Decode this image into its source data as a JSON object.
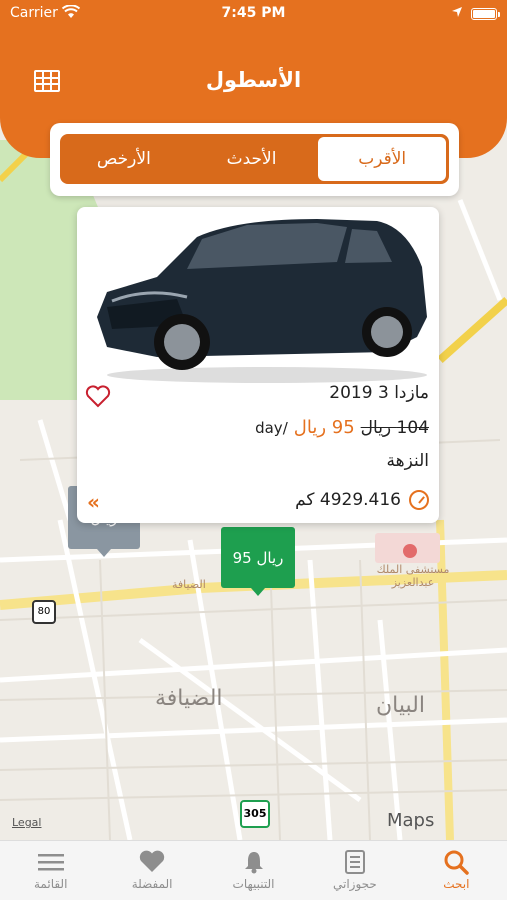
{
  "status_bar": {
    "carrier": "Carrier",
    "time": "7:45 PM"
  },
  "header": {
    "title": "الأسطول",
    "grid_icon": "grid-icon"
  },
  "sort": {
    "options": [
      {
        "label": "الأرخص",
        "active": false
      },
      {
        "label": "الأحدث",
        "active": false
      },
      {
        "label": "الأقرب",
        "active": true
      }
    ]
  },
  "car": {
    "name": "مازدا 3 2019",
    "old_price": "104 ريال",
    "price": "95 ريال",
    "per": "/day",
    "location": "النزهة",
    "distance": "4929.416 كم"
  },
  "map": {
    "pin_price": "95 ريال",
    "gray_pin_text": "ريال",
    "places": {
      "hospital": "مستشفى الملك عبدالعزيز",
      "dhiyafa": "الضيافة",
      "bayan": "البيان",
      "poi": "الضيافة",
      "road_80": "80",
      "road_305": "305"
    },
    "maps_label": "Maps",
    "legal": "Legal"
  },
  "tabs": [
    {
      "label": "القائمة",
      "icon": "list-icon",
      "active": false
    },
    {
      "label": "المفضلة",
      "icon": "heart-icon",
      "active": false
    },
    {
      "label": "التنبيهات",
      "icon": "bell-icon",
      "active": false
    },
    {
      "label": "حجوزاتي",
      "icon": "booking-icon",
      "active": false
    },
    {
      "label": "ابحث",
      "icon": "search-icon",
      "active": true
    }
  ],
  "colors": {
    "accent": "#e5711f",
    "green": "#1e9f4f",
    "gray_pin": "#8a96a1"
  }
}
